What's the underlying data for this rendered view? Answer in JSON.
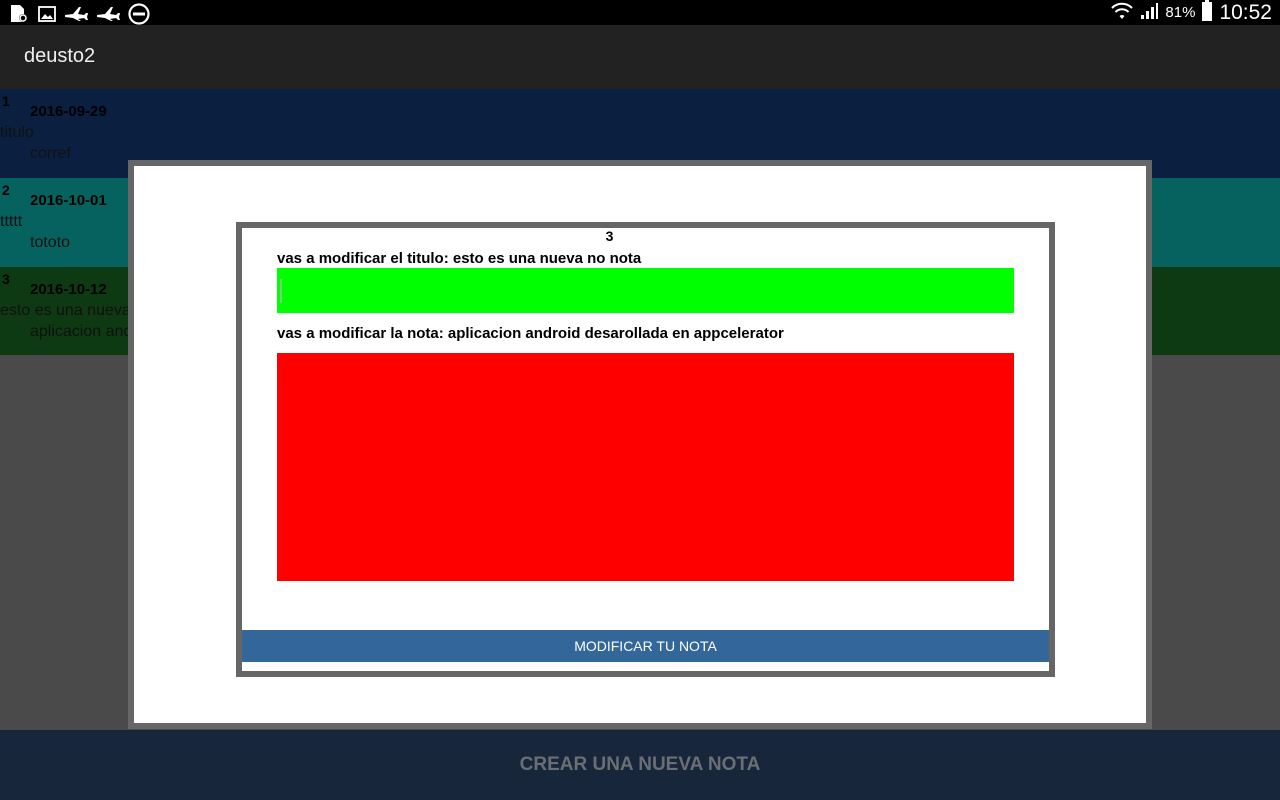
{
  "status_bar": {
    "left_icons": [
      "sd-card-settings-icon",
      "image-icon",
      "airplane-icon",
      "airplane-icon",
      "do-not-disturb-icon"
    ],
    "battery_pct": "81%",
    "time": "10:52"
  },
  "app": {
    "title": "deusto2"
  },
  "notes": [
    {
      "id": "1",
      "date": "2016-09-29",
      "title": "titulo",
      "note": "corref",
      "color": "#0b1f40"
    },
    {
      "id": "2",
      "date": "2016-10-01",
      "title": "ttttt",
      "note": "tototo",
      "color": "#06625f"
    },
    {
      "id": "3",
      "date": "2016-10-12",
      "title": "esto es una nueva no nota",
      "note": "aplicacion android desarollada en appcelerator",
      "color": "#0d3a12"
    }
  ],
  "dialog": {
    "id": "3",
    "title_label": "vas a modificar el titulo: esto es una nueva no nota",
    "title_value": "",
    "note_label": "vas a modificar la nota: aplicacion android desarollada en appcelerator",
    "note_value": "",
    "submit_label": "MODIFICAR TU NOTA",
    "title_field_color": "#00ff00",
    "note_field_color": "#ff0000",
    "button_color": "#336699"
  },
  "footer": {
    "new_note_label": "CREAR UNA NUEVA NOTA"
  }
}
